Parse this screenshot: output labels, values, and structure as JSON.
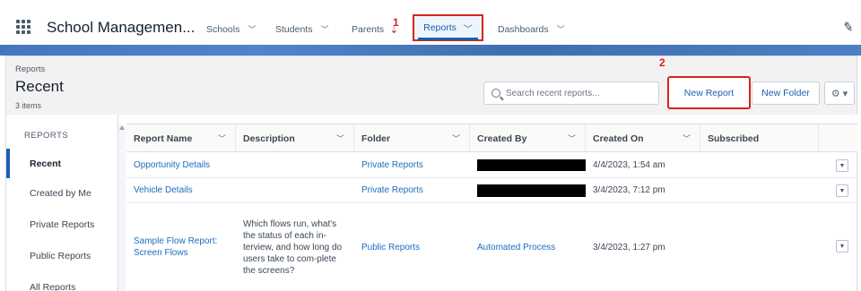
{
  "app": {
    "name": "School Managemen..."
  },
  "nav": {
    "items": [
      {
        "label": "Schools"
      },
      {
        "label": "Students"
      },
      {
        "label": "Parents"
      },
      {
        "label": "Reports",
        "active": true
      },
      {
        "label": "Dashboards"
      }
    ]
  },
  "annotations": {
    "marker_1": "1",
    "marker_2": "2"
  },
  "header": {
    "breadcrumb": "Reports",
    "title": "Recent",
    "count": "3 items",
    "search_placeholder": "Search recent reports...",
    "new_report": "New Report",
    "new_folder": "New Folder",
    "gear": "⚙ ▾"
  },
  "sidebar": {
    "heading": "REPORTS",
    "items": [
      {
        "label": "Recent",
        "active": true
      },
      {
        "label": "Created by Me"
      },
      {
        "label": "Private Reports"
      },
      {
        "label": "Public Reports"
      },
      {
        "label": "All Reports"
      }
    ]
  },
  "table": {
    "columns": [
      "Report Name",
      "Description",
      "Folder",
      "Created By",
      "Created On",
      "Subscribed"
    ],
    "rows": [
      {
        "name": "Opportunity Details",
        "description": "",
        "folder": "Private Reports",
        "created_by": "",
        "created_on": "4/4/2023, 1:54 am"
      },
      {
        "name": "Vehicle Details",
        "description": "",
        "folder": "Private Reports",
        "created_by": "",
        "created_on": "3/4/2023, 7:12 pm"
      },
      {
        "name": "Sample Flow Report: Screen Flows",
        "description": "Which flows run, what's the status of each in-terview, and how long do users take to com-plete the screens?",
        "folder": "Public Reports",
        "created_by": "Automated Process",
        "created_on": "3/4/2023, 1:27 pm"
      }
    ]
  },
  "colors": {
    "accent": "#1b5fb0",
    "annotation_red": "#d6231a",
    "link": "#1b6dc1"
  }
}
